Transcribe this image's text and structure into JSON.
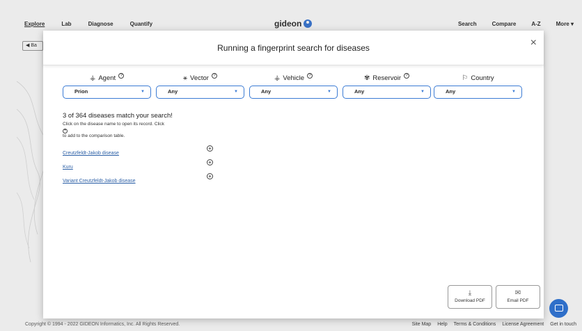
{
  "nav": {
    "left": [
      "Explore",
      "Lab",
      "Diagnose",
      "Quantify"
    ],
    "logo": "gideon",
    "right": [
      "Search",
      "Compare",
      "A-Z",
      "More ▾"
    ]
  },
  "back_label": "◀ Ba",
  "modal": {
    "title": "Running a fingerprint search for diseases",
    "close": "×"
  },
  "filters": [
    {
      "label": "Agent",
      "icon": "agent-icon",
      "glyph": "⚶",
      "value": "Prion"
    },
    {
      "label": "Vector",
      "icon": "vector-icon",
      "glyph": "⚹",
      "value": "Any"
    },
    {
      "label": "Vehicle",
      "icon": "vehicle-icon",
      "glyph": "⚶",
      "value": "Any"
    },
    {
      "label": "Reservoir",
      "icon": "reservoir-icon",
      "glyph": "✾",
      "value": "Any"
    },
    {
      "label": "Country",
      "icon": "flag-icon",
      "glyph": "⚐",
      "value": "Any"
    }
  ],
  "results": {
    "count_text": "3 of 364 diseases match your search!",
    "instr_1": "Click on the disease name to open its record. Click",
    "instr_2": "to add to the comparison table.",
    "diseases": [
      "Creutzfeldt-Jakob disease",
      "Kuru",
      "Variant Creutzfeldt-Jakob disease"
    ]
  },
  "buttons": {
    "download_pdf": "Download PDF",
    "email_pdf": "Email PDF"
  },
  "footer": {
    "copyright": "Copyright © 1994 - 2022 GIDEON Informatics, Inc. All Rights Reserved.",
    "links": [
      "Site Map",
      "Help",
      "Terms & Conditions",
      "License Agreement",
      "Get in touch"
    ]
  }
}
